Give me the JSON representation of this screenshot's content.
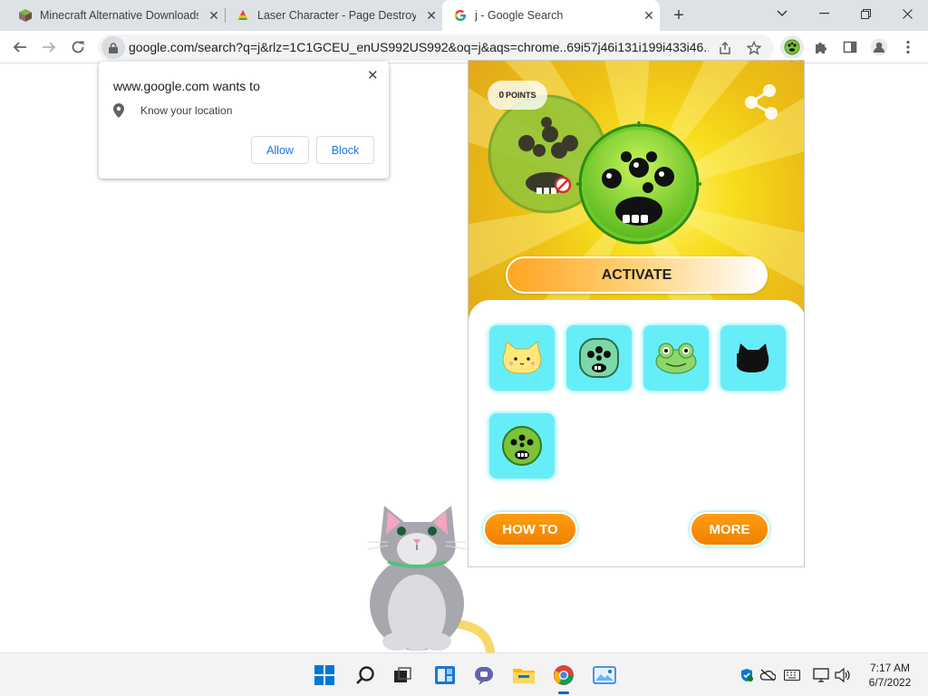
{
  "tabs": [
    {
      "title": "Minecraft Alternative Downloads",
      "icon": "minecraft-cube-icon"
    },
    {
      "title": "Laser Character - Page Destroyer",
      "icon": "laser-extension-icon"
    },
    {
      "title": "j - Google Search",
      "icon": "google-g-icon",
      "active": true
    }
  ],
  "window": {
    "minimize": "minimize",
    "maximize": "restore",
    "close": "close"
  },
  "toolbar": {
    "url": "google.com/search?q=j&rlz=1C1GCEU_enUS992US992&oq=j&aqs=chrome..69i57j46i131i199i433i46..."
  },
  "permission": {
    "site": "www.google.com wants to",
    "request": "Know your location",
    "allow": "Allow",
    "block": "Block"
  },
  "extension": {
    "points_value": "0",
    "points_label": "POINTS",
    "activate": "ACTIVATE",
    "characters": [
      "cat",
      "green-monster",
      "frog",
      "black-cat",
      "lime-monster"
    ],
    "how_to": "HOW TO",
    "more": "MORE",
    "accent": "#66eef8",
    "button_color": "#f08100"
  },
  "taskbar": {
    "apps": [
      "windows-start-icon",
      "search-icon",
      "task-view-icon",
      "widgets-icon",
      "teams-chat-icon",
      "file-explorer-icon",
      "chrome-icon",
      "photos-icon"
    ],
    "time": "7:17 AM",
    "date": "6/7/2022"
  }
}
